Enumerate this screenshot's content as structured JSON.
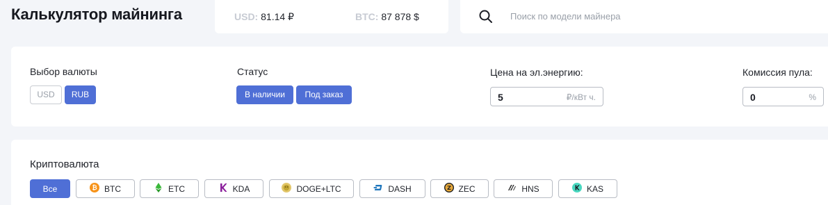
{
  "header": {
    "title": "Калькулятор майнинга",
    "rates": {
      "usd_key": "USD:",
      "usd_value": "81.14 ₽",
      "btc_key": "BTC:",
      "btc_value": "87 878 $"
    },
    "search": {
      "placeholder": "Поиск по модели майнера"
    }
  },
  "filters": {
    "currency": {
      "label": "Выбор валюты",
      "options": [
        "USD",
        "RUB"
      ],
      "selected": "RUB"
    },
    "status": {
      "label": "Статус",
      "options": [
        "В наличии",
        "Под заказ"
      ]
    },
    "energy": {
      "label": "Цена на эл.энергию:",
      "value": "5",
      "unit": "₽/кВт ч."
    },
    "pool": {
      "label": "Комиссия пула:",
      "value": "0",
      "unit": "%"
    }
  },
  "crypto": {
    "label": "Криптовалюта",
    "items": [
      {
        "label": "Все",
        "icon": "",
        "active": true
      },
      {
        "label": "BTC",
        "icon": "bitcoin-icon",
        "color": "#f7931a"
      },
      {
        "label": "ETC",
        "icon": "ethereum-classic-icon",
        "color": "#3ab83a"
      },
      {
        "label": "KDA",
        "icon": "kadena-icon",
        "color": "#8a1e9b"
      },
      {
        "label": "DOGE+LTC",
        "icon": "dogecoin-icon",
        "color": "#c2a633"
      },
      {
        "label": "DASH",
        "icon": "dash-icon",
        "color": "#1c75bc"
      },
      {
        "label": "ZEC",
        "icon": "zcash-icon",
        "color": "#e8a93a"
      },
      {
        "label": "HNS",
        "icon": "handshake-icon",
        "color": "#222222"
      },
      {
        "label": "KAS",
        "icon": "kaspa-icon",
        "color": "#49d8c0"
      }
    ]
  }
}
